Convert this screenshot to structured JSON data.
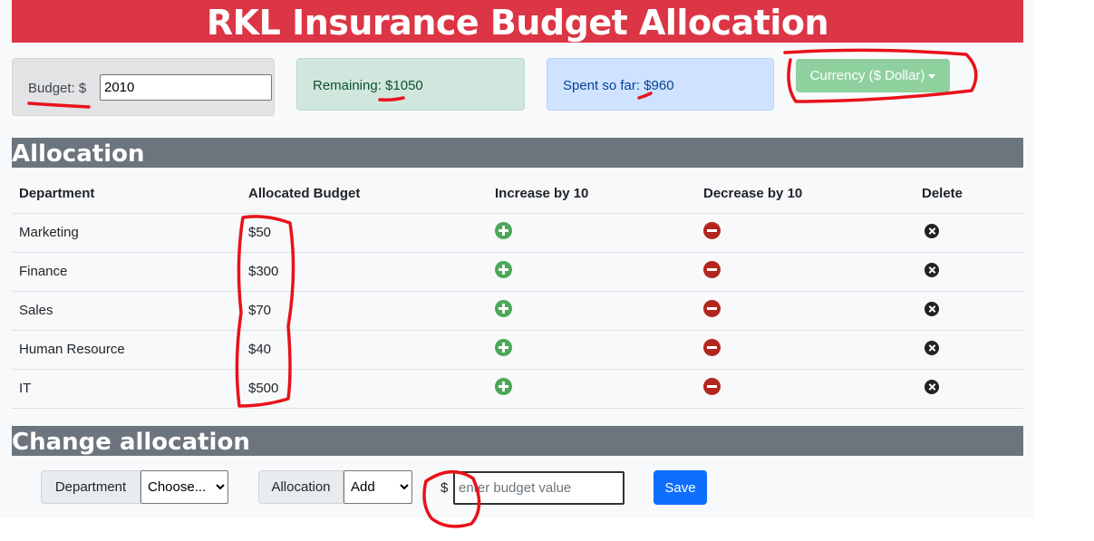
{
  "header": {
    "title": "RKL Insurance Budget Allocation"
  },
  "budget": {
    "label": "Budget: $",
    "value": "2010"
  },
  "remaining": {
    "label": "Remaining: ",
    "value": "$1050"
  },
  "spent": {
    "label": "Spent so far: ",
    "value": "$960"
  },
  "currency": {
    "label": "Currency ($ Dollar)"
  },
  "allocation": {
    "title": "Allocation",
    "columns": [
      "Department",
      "Allocated Budget",
      "Increase by 10",
      "Decrease by 10",
      "Delete"
    ],
    "rows": [
      {
        "department": "Marketing",
        "budget": "$50"
      },
      {
        "department": "Finance",
        "budget": "$300"
      },
      {
        "department": "Sales",
        "budget": "$70"
      },
      {
        "department": "Human Resource",
        "budget": "$40"
      },
      {
        "department": "IT",
        "budget": "$500"
      }
    ]
  },
  "change": {
    "title": "Change allocation",
    "department_label": "Department",
    "department_select": "Choose...",
    "allocation_label": "Allocation",
    "allocation_select": "Add",
    "currency_symbol": "$",
    "value_placeholder": "enter budget value",
    "save_label": "Save"
  },
  "colors": {
    "header": "#dc3545",
    "section": "#6c757d",
    "increase": "#4aa857",
    "decrease": "#b3261e",
    "save": "#0d6efd",
    "currency_button": "#8fd19e",
    "annotation": "#e8121c"
  },
  "icons": {
    "increase": "plus-circle-icon",
    "decrease": "minus-circle-icon",
    "delete": "x-circle-icon"
  }
}
